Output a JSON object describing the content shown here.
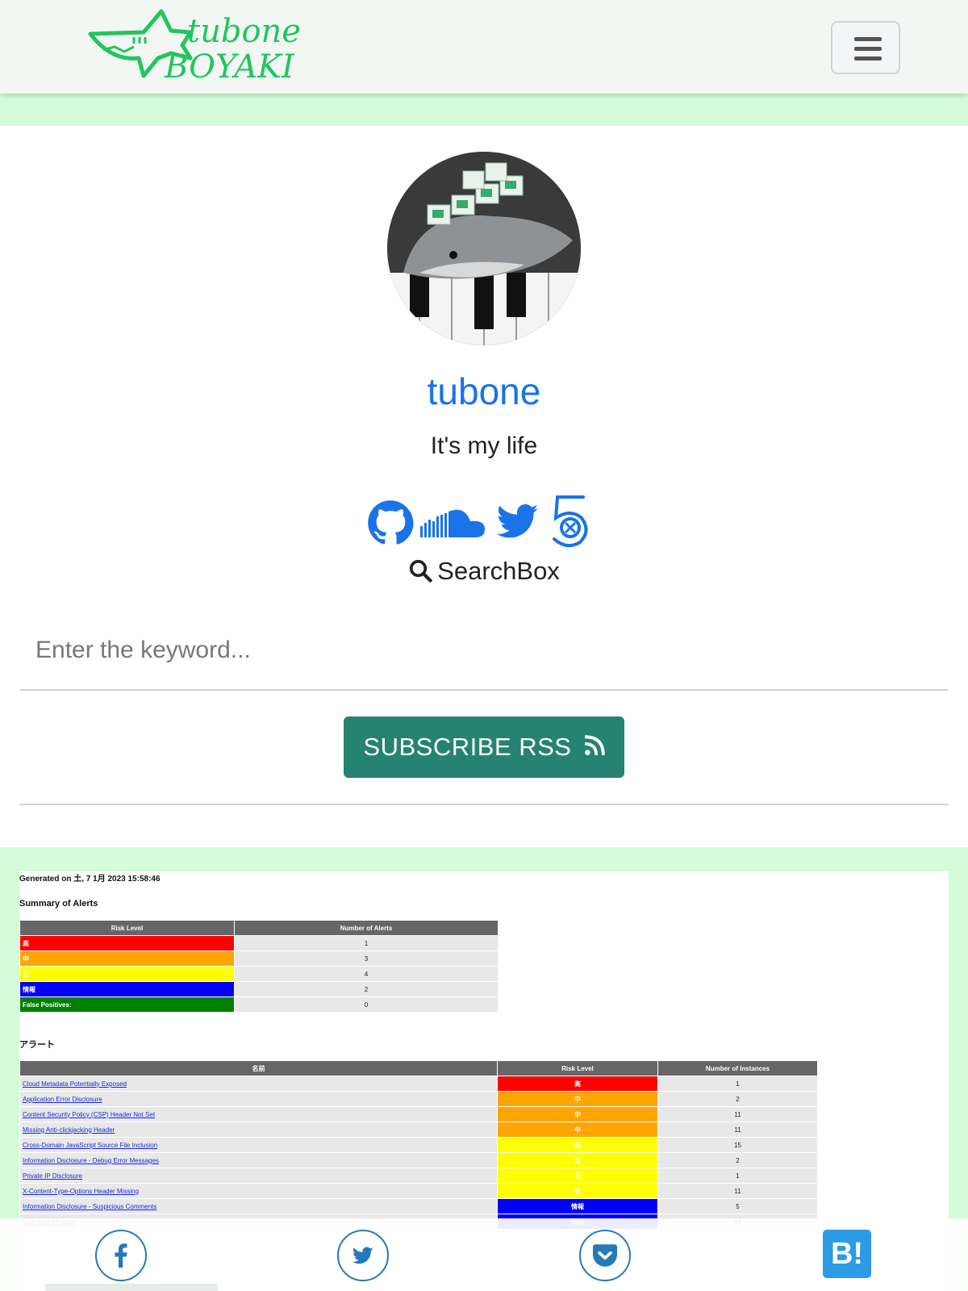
{
  "header": {
    "logo_top": "tubone",
    "logo_bottom": "BOYAKI",
    "menu_icon": "hamburger-menu-icon"
  },
  "profile": {
    "name": "tubone",
    "tagline": "It's my life",
    "social": [
      {
        "icon": "github-icon"
      },
      {
        "icon": "soundcloud-icon"
      },
      {
        "icon": "twitter-icon"
      },
      {
        "icon": "500px-icon"
      }
    ]
  },
  "search": {
    "title": "SearchBox",
    "icon": "search-icon",
    "placeholder": "Enter the keyword..."
  },
  "subscribe": {
    "label": "SUBSCRIBE RSS",
    "icon": "rss-icon"
  },
  "report": {
    "generated": "Generated on 土, 7 1月 2023 15:58:46",
    "summary_heading": "Summary of Alerts",
    "summary_headers": [
      "Risk Level",
      "Number of Alerts"
    ],
    "summary_rows": [
      {
        "level": "高",
        "count": "1",
        "color": "#ff0000"
      },
      {
        "level": "中",
        "count": "3",
        "color": "#ffa500"
      },
      {
        "level": "低",
        "count": "4",
        "color": "#ffff00"
      },
      {
        "level": "情報",
        "count": "2",
        "color": "#0000ff"
      },
      {
        "level": "False Positives:",
        "count": "0",
        "color": "#008000"
      }
    ],
    "alerts_heading": "アラート",
    "alerts_headers": [
      "名前",
      "Risk Level",
      "Number of Instances"
    ],
    "alerts_rows": [
      {
        "name": "Cloud Metadata Potentially Exposed",
        "level": "高",
        "count": "1",
        "color": "#ff0000"
      },
      {
        "name": "Application Error Disclosure",
        "level": "中",
        "count": "2",
        "color": "#ffa500"
      },
      {
        "name": "Content Security Policy (CSP) Header Not Set",
        "level": "中",
        "count": "11",
        "color": "#ffa500"
      },
      {
        "name": "Missing Anti-clickjacking Header",
        "level": "中",
        "count": "11",
        "color": "#ffa500"
      },
      {
        "name": "Cross-Domain JavaScript Source File Inclusion",
        "level": "低",
        "count": "15",
        "color": "#ffff00"
      },
      {
        "name": "Information Disclosure - Debug Error Messages",
        "level": "低",
        "count": "2",
        "color": "#ffff00"
      },
      {
        "name": "Private IP Disclosure",
        "level": "低",
        "count": "1",
        "color": "#ffff00"
      },
      {
        "name": "X-Content-Type-Options Header Missing",
        "level": "低",
        "count": "11",
        "color": "#ffff00"
      },
      {
        "name": "Information Disclosure - Suspicious Comments",
        "level": "情報",
        "count": "5",
        "color": "#0000ff"
      },
      {
        "name": "User Agent Fuzzer",
        "level": "情報",
        "count": "84",
        "color": "#0000ff"
      }
    ]
  },
  "share": {
    "items": [
      {
        "icon": "facebook-icon"
      },
      {
        "icon": "twitter-icon"
      },
      {
        "icon": "pocket-icon"
      },
      {
        "icon": "hatena-bookmark-icon",
        "label": "B!"
      }
    ]
  },
  "colors": {
    "accent_green": "#d3fcd7",
    "button_teal": "#268271",
    "link_blue": "#1a73e8",
    "logo_green": "#22c55e",
    "share_blue": "#2679b9"
  }
}
